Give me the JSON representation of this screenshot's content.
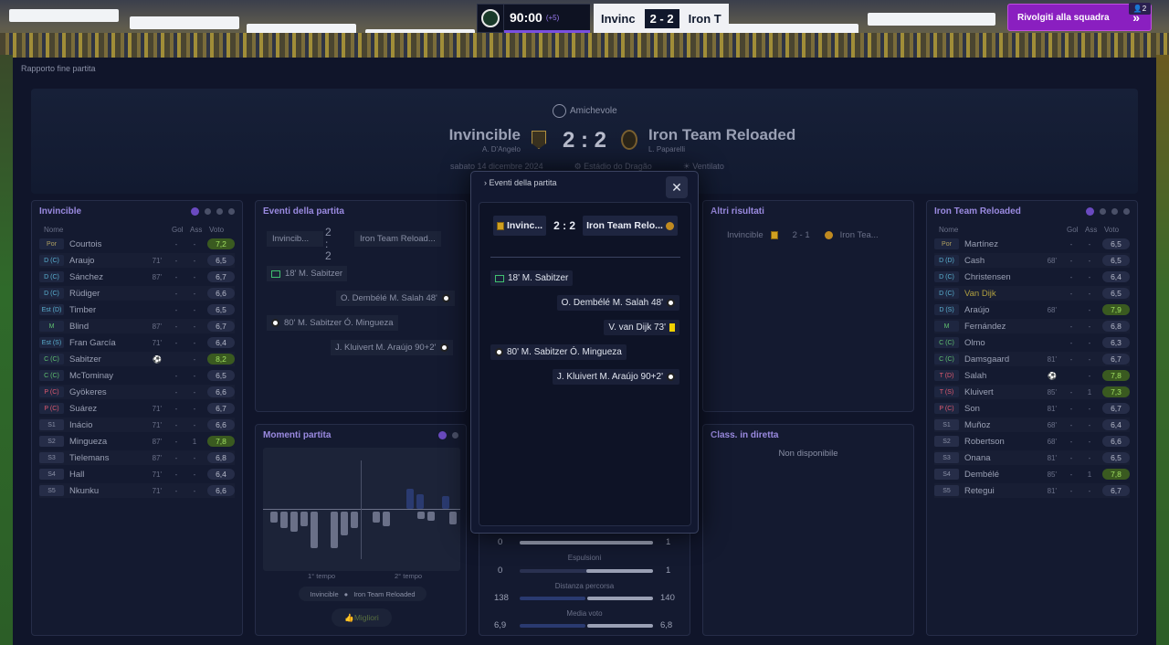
{
  "topbar": {
    "time": "90:00",
    "extra": "(+5)",
    "home_short": "Invinc",
    "score": "2 - 2",
    "away_short": "Iron T",
    "button": "Rivolgiti alla squadra",
    "badge": "2"
  },
  "breadcrumb": "Rapporto fine partita",
  "match": {
    "competition": "Amichevole",
    "home": "Invincible",
    "home_manager": "A. D'Angelo",
    "away": "Iron Team Reloaded",
    "away_manager": "L. Paparelli",
    "score": "2 : 2",
    "date": "sabato 14 dicembre 2024",
    "stadium": "Estádio do Dragão",
    "weather": "Ventilato"
  },
  "lineup_home": {
    "title": "Invincible",
    "cols": {
      "name": "Nome",
      "gol": "Gol",
      "ass": "Ass",
      "voto": "Voto"
    },
    "rows": [
      {
        "pos": "Por",
        "cls": "gk",
        "name": "Courtois",
        "sub": "",
        "gol": "-",
        "ass": "-",
        "voto": "7,2",
        "hi": true
      },
      {
        "pos": "D (C)",
        "cls": "def",
        "name": "Araujo",
        "sub": "71'",
        "gol": "-",
        "ass": "-",
        "voto": "6,5"
      },
      {
        "pos": "D (C)",
        "cls": "def",
        "name": "Sánchez",
        "sub": "87'",
        "gol": "-",
        "ass": "-",
        "voto": "6,7"
      },
      {
        "pos": "D (C)",
        "cls": "def",
        "name": "Rüdiger",
        "sub": "",
        "gol": "-",
        "ass": "-",
        "voto": "6,6"
      },
      {
        "pos": "Est (D)",
        "cls": "def",
        "name": "Timber",
        "sub": "",
        "gol": "-",
        "ass": "-",
        "voto": "6,5"
      },
      {
        "pos": "M",
        "cls": "mid",
        "name": "Blind",
        "sub": "87'",
        "gol": "-",
        "ass": "-",
        "voto": "6,7"
      },
      {
        "pos": "Est (S)",
        "cls": "def",
        "name": "Fran García",
        "sub": "71'",
        "gol": "-",
        "ass": "-",
        "voto": "6,4"
      },
      {
        "pos": "C (C)",
        "cls": "mid",
        "name": "Sabitzer",
        "sub": "⚽",
        "gol": "",
        "ass": "-",
        "voto": "8,2",
        "hi": true
      },
      {
        "pos": "C (C)",
        "cls": "mid",
        "name": "McTominay",
        "sub": "",
        "gol": "-",
        "ass": "-",
        "voto": "6,5"
      },
      {
        "pos": "P (C)",
        "cls": "att",
        "name": "Gyökeres",
        "sub": "",
        "gol": "-",
        "ass": "-",
        "voto": "6,6"
      },
      {
        "pos": "P (C)",
        "cls": "att",
        "name": "Suárez",
        "sub": "71'",
        "gol": "-",
        "ass": "-",
        "voto": "6,7"
      },
      {
        "pos": "S1",
        "cls": "sub",
        "name": "Inácio",
        "sub": "71'",
        "gol": "-",
        "ass": "-",
        "voto": "6,6"
      },
      {
        "pos": "S2",
        "cls": "sub",
        "name": "Mingueza",
        "sub": "87'",
        "gol": "-",
        "ass": "1",
        "voto": "7,8",
        "hi": true
      },
      {
        "pos": "S3",
        "cls": "sub",
        "name": "Tielemans",
        "sub": "87'",
        "gol": "-",
        "ass": "-",
        "voto": "6,8"
      },
      {
        "pos": "S4",
        "cls": "sub",
        "name": "Hall",
        "sub": "71'",
        "gol": "-",
        "ass": "-",
        "voto": "6,4"
      },
      {
        "pos": "S5",
        "cls": "sub",
        "name": "Nkunku",
        "sub": "71'",
        "gol": "-",
        "ass": "-",
        "voto": "6,6"
      }
    ]
  },
  "lineup_away": {
    "title": "Iron Team Reloaded",
    "cols": {
      "name": "Nome",
      "gol": "Gol",
      "ass": "Ass",
      "voto": "Voto"
    },
    "rows": [
      {
        "pos": "Por",
        "cls": "gk",
        "name": "Martínez",
        "sub": "",
        "gol": "-",
        "ass": "-",
        "voto": "6,5"
      },
      {
        "pos": "D (D)",
        "cls": "def",
        "name": "Cash",
        "sub": "68'",
        "gol": "-",
        "ass": "-",
        "voto": "6,5"
      },
      {
        "pos": "D (C)",
        "cls": "def",
        "name": "Christensen",
        "sub": "",
        "gol": "-",
        "ass": "-",
        "voto": "6,4"
      },
      {
        "pos": "D (C)",
        "cls": "def",
        "name": "Van Dijk",
        "sub": "",
        "gol": "-",
        "ass": "-",
        "voto": "6,5",
        "yc": true
      },
      {
        "pos": "D (S)",
        "cls": "def",
        "name": "Araújo",
        "sub": "68'",
        "gol": "",
        "ass": "-",
        "voto": "7,9",
        "hi": true
      },
      {
        "pos": "M",
        "cls": "mid",
        "name": "Fernández",
        "sub": "",
        "gol": "-",
        "ass": "-",
        "voto": "6,8"
      },
      {
        "pos": "C (C)",
        "cls": "mid",
        "name": "Olmo",
        "sub": "",
        "gol": "-",
        "ass": "-",
        "voto": "6,3"
      },
      {
        "pos": "C (C)",
        "cls": "mid",
        "name": "Damsgaard",
        "sub": "81'",
        "gol": "-",
        "ass": "-",
        "voto": "6,7"
      },
      {
        "pos": "T (D)",
        "cls": "att",
        "name": "Salah",
        "sub": "⚽",
        "gol": "",
        "ass": "-",
        "voto": "7,8",
        "hi": true
      },
      {
        "pos": "T (S)",
        "cls": "att",
        "name": "Kluivert",
        "sub": "85'",
        "gol": "-",
        "ass": "1",
        "voto": "7,3",
        "hi": true
      },
      {
        "pos": "P (C)",
        "cls": "att",
        "name": "Son",
        "sub": "81'",
        "gol": "-",
        "ass": "-",
        "voto": "6,7"
      },
      {
        "pos": "S1",
        "cls": "sub",
        "name": "Muñoz",
        "sub": "68'",
        "gol": "-",
        "ass": "-",
        "voto": "6,4"
      },
      {
        "pos": "S2",
        "cls": "sub",
        "name": "Robertson",
        "sub": "68'",
        "gol": "-",
        "ass": "-",
        "voto": "6,6"
      },
      {
        "pos": "S3",
        "cls": "sub",
        "name": "Onana",
        "sub": "81'",
        "gol": "-",
        "ass": "-",
        "voto": "6,5"
      },
      {
        "pos": "S4",
        "cls": "sub",
        "name": "Dembélé",
        "sub": "85'",
        "gol": "-",
        "ass": "1",
        "voto": "7,8",
        "hi": true
      },
      {
        "pos": "S5",
        "cls": "sub",
        "name": "Retegui",
        "sub": "81'",
        "gol": "-",
        "ass": "-",
        "voto": "6,7"
      }
    ]
  },
  "events_panel": {
    "title": "Eventi della partita",
    "home": "Invincib...",
    "away": "Iron Team Reload...",
    "score": "2 : 2",
    "events": [
      "18' M. Sabitzer",
      "O. Dembélé  M. Salah 48'",
      "80' M. Sabitzer Ó. Mingueza",
      "J. Kluivert  M. Araújo 90+2'"
    ]
  },
  "moments": {
    "title": "Momenti partita",
    "half1": "1° tempo",
    "half2": "2° tempo",
    "legend_home": "Invincible",
    "legend_away": "Iron Team Reloaded",
    "button": "Migliori"
  },
  "other": {
    "title": "Altri risultati",
    "home": "Invincible",
    "score": "2 - 1",
    "away": "Iron Tea..."
  },
  "live": {
    "title": "Class. in diretta",
    "empty": "Non disponibile"
  },
  "stats": [
    {
      "label": "Espulsioni",
      "home": "0",
      "away": "1",
      "row_home": "0"
    },
    {
      "label": "Distanza percorsa",
      "home": "138",
      "away": "140"
    },
    {
      "label": "Media voto",
      "home": "6,9",
      "away": "6,8"
    }
  ],
  "stats_partial": {
    "home": "0",
    "away": "1"
  },
  "modal": {
    "title": "Eventi della partita",
    "home": "Invinc...",
    "away": "Iron Team Relo...",
    "score": "2 : 2",
    "events": [
      {
        "text": "18' M. Sabitzer",
        "side": "L",
        "icon": "pen"
      },
      {
        "text": "O. Dembélé  M. Salah 48'",
        "side": "R",
        "icon": "ball"
      },
      {
        "text": "V. van Dijk 73'",
        "side": "R",
        "icon": "yc"
      },
      {
        "text": "80' M. Sabitzer Ó. Mingueza",
        "side": "L",
        "icon": "ball"
      },
      {
        "text": "J. Kluivert  M. Araújo 90+2'",
        "side": "R",
        "icon": "ball"
      }
    ]
  },
  "colors": {
    "accent": "#7a4fe0",
    "panel_title": "#9a8ae0",
    "rating_high": "#a0e060"
  }
}
